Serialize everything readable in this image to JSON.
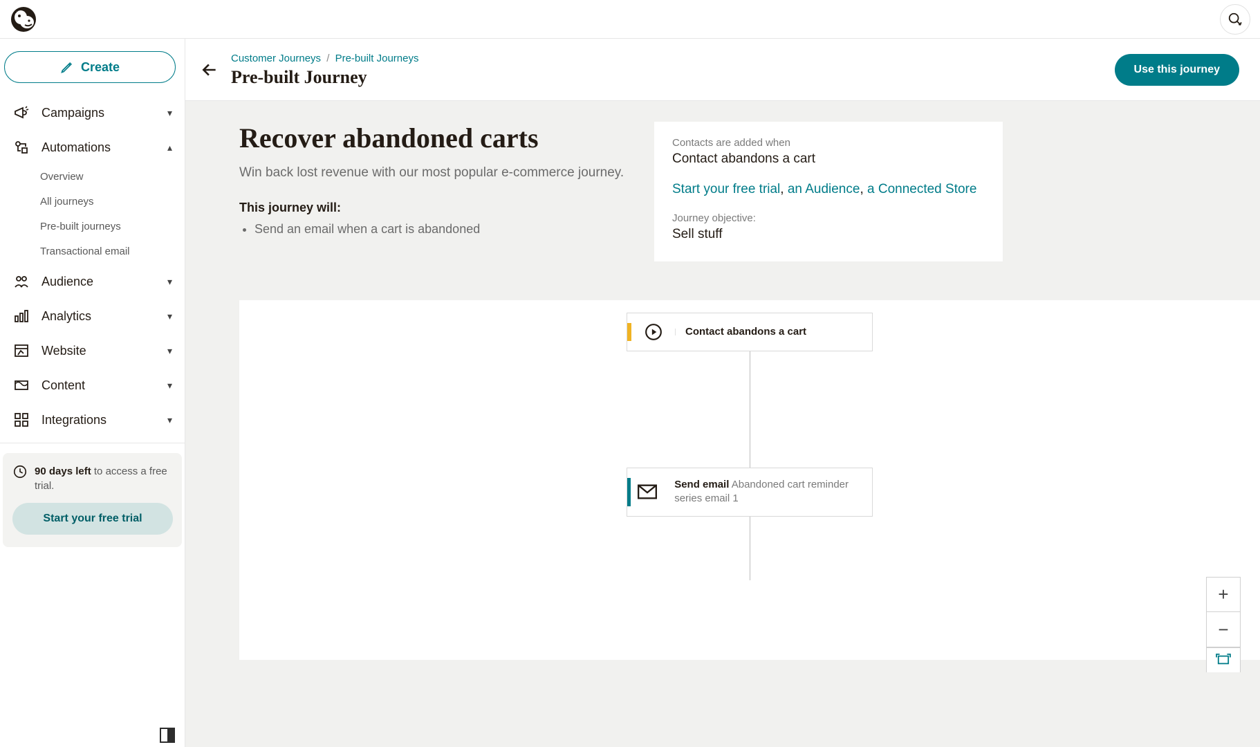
{
  "create_label": "Create",
  "sidebar": {
    "items": [
      {
        "label": "Campaigns",
        "chev": "down"
      },
      {
        "label": "Automations",
        "chev": "up"
      },
      {
        "label": "Audience",
        "chev": "down"
      },
      {
        "label": "Analytics",
        "chev": "down"
      },
      {
        "label": "Website",
        "chev": "down"
      },
      {
        "label": "Content",
        "chev": "down"
      },
      {
        "label": "Integrations",
        "chev": "down"
      }
    ],
    "automations_sub": [
      "Overview",
      "All journeys",
      "Pre-built journeys",
      "Transactional email"
    ]
  },
  "trial": {
    "days_left": "90 days left",
    "text_suffix": " to access a free trial.",
    "button": "Start your free trial"
  },
  "breadcrumbs": {
    "a": "Customer Journeys",
    "b": "Pre-built Journeys"
  },
  "page_title": "Pre-built Journey",
  "primary_action": "Use this journey",
  "hero": {
    "title": "Recover abandoned carts",
    "subtitle": "Win back lost revenue with our most popular e-commerce journey.",
    "will_title": "This journey will:",
    "bullets": [
      "Send an email when a cart is abandoned"
    ]
  },
  "panel": {
    "added_when_label": "Contacts are added when",
    "added_when_value": "Contact abandons a cart",
    "links": {
      "trial": "Start your free trial",
      "audience": "an Audience",
      "store": "a Connected Store"
    },
    "objective_label": "Journey objective:",
    "objective_value": "Sell stuff"
  },
  "flow": {
    "start_label": "Contact abandons a cart",
    "email_prefix": "Send email",
    "email_name": "Abandoned cart reminder series email 1"
  }
}
